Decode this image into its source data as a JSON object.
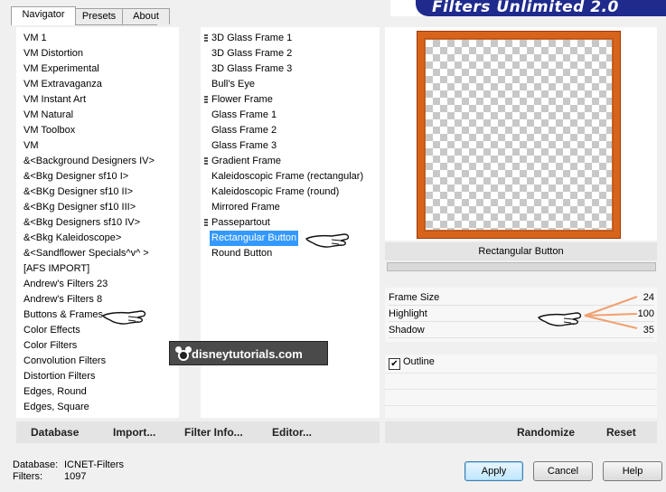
{
  "tabs": [
    {
      "label": "Navigator",
      "active": true
    },
    {
      "label": "Presets",
      "active": false
    },
    {
      "label": "About",
      "active": false
    }
  ],
  "banner_title": "Filters Unlimited 2.0",
  "categories": [
    "VM 1",
    "VM Distortion",
    "VM Experimental",
    "VM Extravaganza",
    "VM Instant Art",
    "VM Natural",
    "VM Toolbox",
    "VM",
    "&<Background Designers IV>",
    "&<Bkg Designer sf10 I>",
    "&<BKg Designer sf10 II>",
    "&<BKg Designer sf10 III>",
    "&<Bkg Designers sf10 IV>",
    "&<Bkg Kaleidoscope>",
    "&<Sandflower Specials^v^ >",
    "[AFS IMPORT]",
    "Andrew's Filters 23",
    "Andrew's Filters 8",
    "Buttons & Frames",
    "Color Effects",
    "Color Filters",
    "Convolution Filters",
    "Distortion Filters",
    "Edges, Round",
    "Edges, Square"
  ],
  "filters": [
    {
      "label": "3D Glass Frame 1",
      "group": true
    },
    {
      "label": "3D Glass Frame 2",
      "group": false
    },
    {
      "label": "3D Glass Frame 3",
      "group": false
    },
    {
      "label": "Bull's Eye",
      "group": false
    },
    {
      "label": "Flower Frame",
      "group": true
    },
    {
      "label": "Glass Frame 1",
      "group": false
    },
    {
      "label": "Glass Frame 2",
      "group": false
    },
    {
      "label": "Glass Frame 3",
      "group": false
    },
    {
      "label": "Gradient Frame",
      "group": true
    },
    {
      "label": "Kaleidoscopic Frame (rectangular)",
      "group": false
    },
    {
      "label": "Kaleidoscopic Frame (round)",
      "group": false
    },
    {
      "label": "Mirrored Frame",
      "group": false
    },
    {
      "label": "Passepartout",
      "group": true
    },
    {
      "label": "Rectangular Button",
      "group": false,
      "selected": true
    },
    {
      "label": "Round Button",
      "group": false
    }
  ],
  "preview": {
    "filter_name": "Rectangular Button"
  },
  "params": [
    {
      "label": "Frame Size",
      "value": "24"
    },
    {
      "label": "Highlight",
      "value": "100"
    },
    {
      "label": "Shadow",
      "value": "35"
    }
  ],
  "options": {
    "outline_label": "Outline",
    "outline_checked": true,
    "check_glyph": "✔"
  },
  "toolbar_left": {
    "database": "Database",
    "import": "Import...",
    "filter_info": "Filter Info...",
    "editor": "Editor..."
  },
  "toolbar_right": {
    "randomize": "Randomize",
    "reset": "Reset"
  },
  "status": {
    "db_label": "Database:",
    "db_value": "ICNET-Filters",
    "filters_label": "Filters:",
    "filters_value": "1097"
  },
  "buttons": {
    "apply": "Apply",
    "cancel": "Cancel",
    "help": "Help"
  },
  "watermark": "disneytutorials.com",
  "scroll_up": "▲",
  "scroll_down": "▼",
  "colors": {
    "accent_blue": "#1e2a8c",
    "selection": "#3399ff",
    "frame_orange": "#d8641c"
  }
}
